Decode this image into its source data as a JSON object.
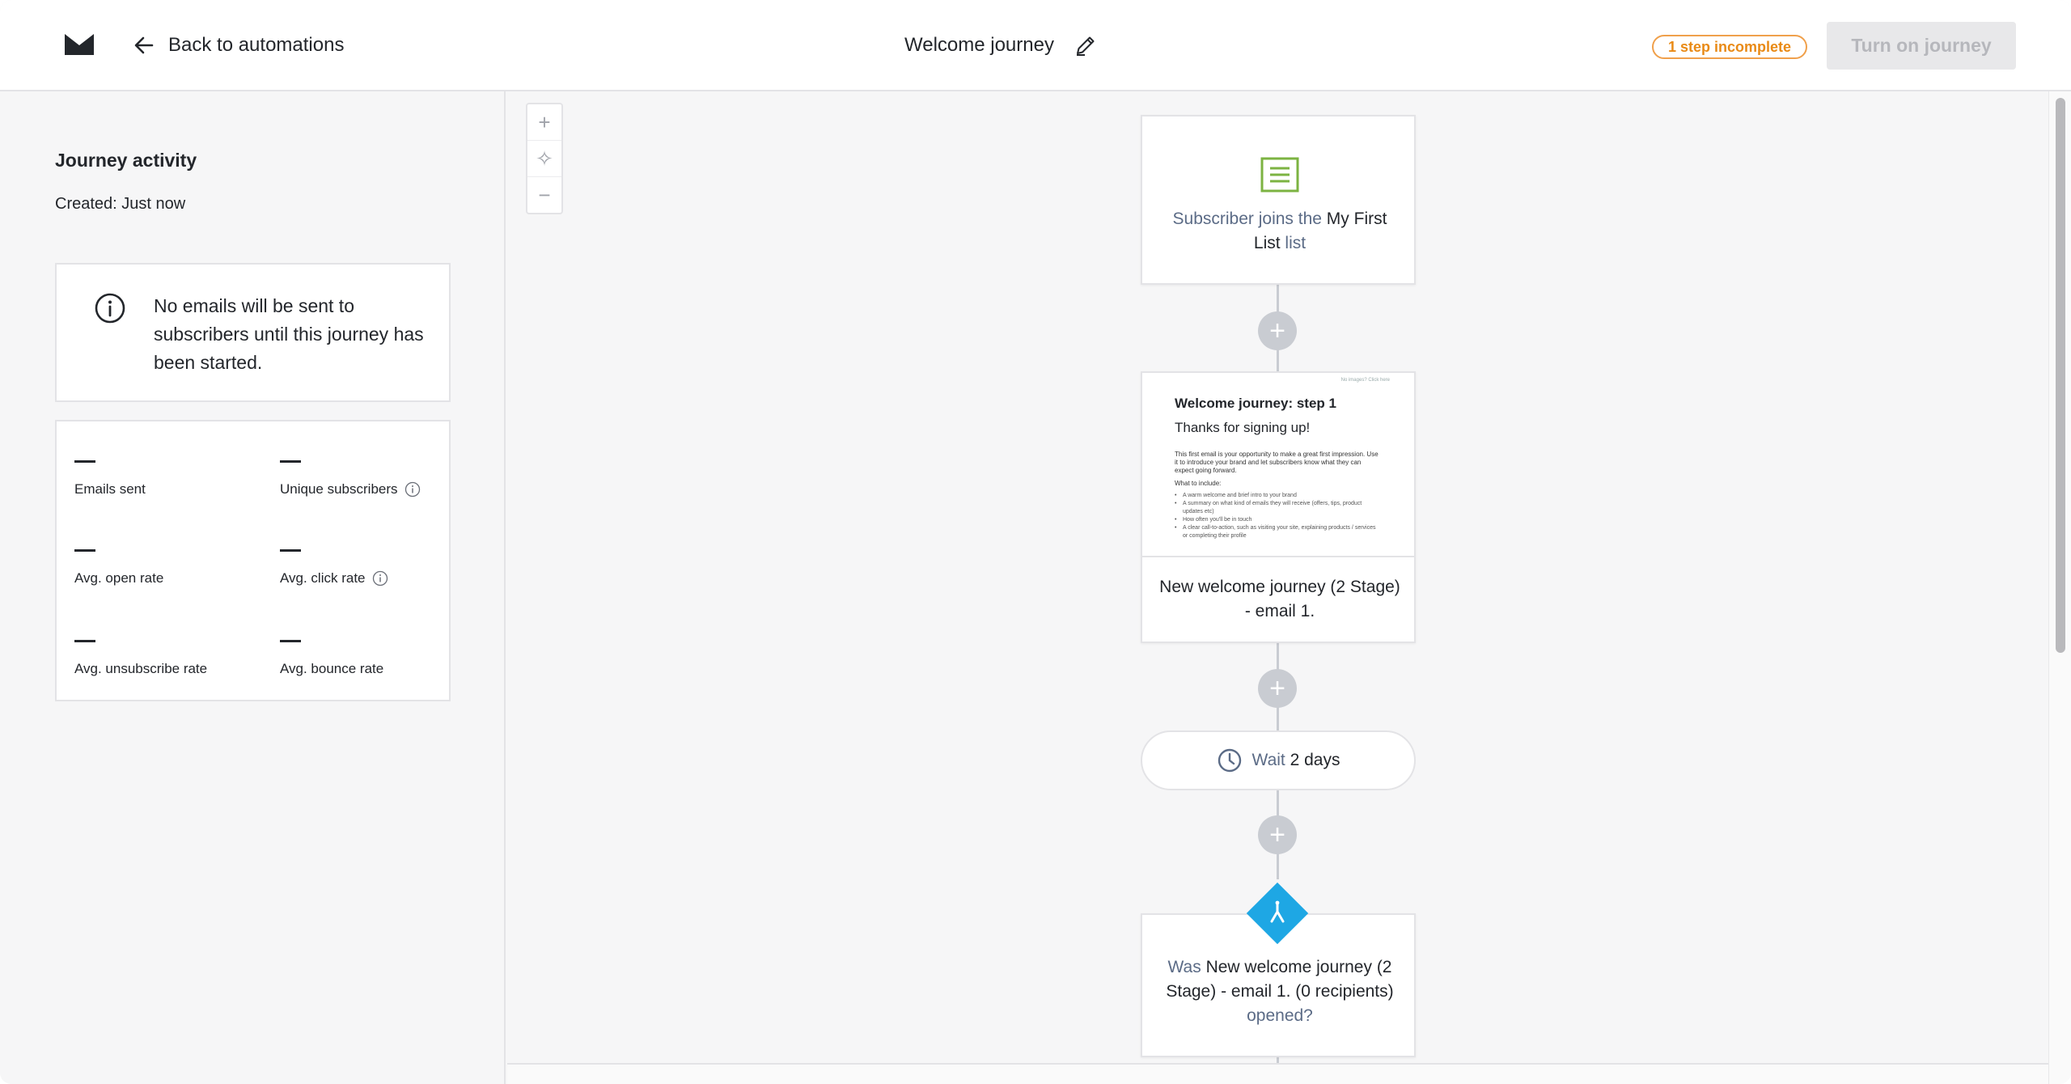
{
  "topbar": {
    "back_label": "Back to automations",
    "title": "Welcome journey",
    "badge": "1 step incomplete",
    "turn_on_label": "Turn on journey"
  },
  "sidebar": {
    "heading": "Journey activity",
    "created": "Created: Just now",
    "notice": "No emails will be sent to subscribers until this journey has been started.",
    "stats": [
      {
        "label": "Emails sent",
        "value": "—"
      },
      {
        "label": "Unique subscribers",
        "value": "—",
        "info": true
      },
      {
        "label": "Avg. open rate",
        "value": "—"
      },
      {
        "label": "Avg. click rate",
        "value": "—",
        "info": true
      },
      {
        "label": "Avg. unsubscribe rate",
        "value": "—"
      },
      {
        "label": "Avg. bounce rate",
        "value": "—"
      }
    ]
  },
  "zoom": {
    "in": "+",
    "fit": "✧",
    "out": "−"
  },
  "flow": {
    "trigger": {
      "pre": "Subscriber joins the ",
      "list": "My First List",
      "post": " list"
    },
    "email": {
      "preview_top": "No images? Click here",
      "preview_title": "Welcome journey: step 1",
      "preview_subtitle": "Thanks for signing up!",
      "preview_para": "This first email is your opportunity to make a great first impression. Use it to introduce your brand and let subscribers know what they can expect going forward.",
      "preview_sub": "What to include:",
      "preview_items": [
        "A warm welcome and brief intro to your brand",
        "A summary on what kind of emails they will receive (offers, tips, product updates etc)",
        "How often you'll be in touch",
        "A clear call-to-action, such as visiting your site, explaining products / services or completing their profile"
      ],
      "caption": "New welcome journey (2 Stage) - email 1."
    },
    "wait": {
      "pre": "Wait ",
      "value": "2 days"
    },
    "condition": {
      "pre": "Was ",
      "subject": "New welcome journey (2 Stage) - email 1. (0 recipients)",
      "post": " opened?"
    },
    "plus": "+"
  },
  "colors": {
    "brand_green": "#7cb342",
    "decision_blue": "#1ea7e4",
    "badge_orange": "#e98a16"
  }
}
